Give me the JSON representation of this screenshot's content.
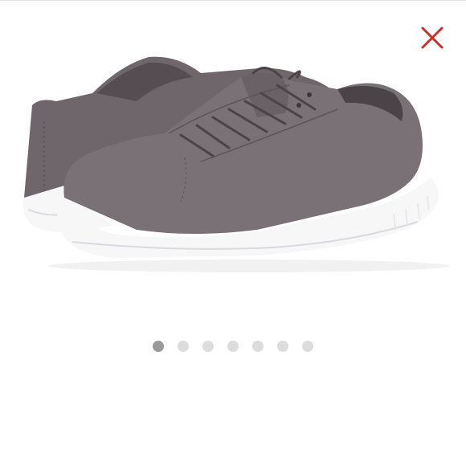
{
  "viewer": {
    "image": {
      "icon": "sneaker-product-image",
      "colors": {
        "suede": "#6f666c",
        "suede_dark": "#4a4347",
        "sole": "#f7f7f8",
        "sole_shadow": "#d9dade"
      }
    },
    "close": {
      "icon": "close-icon",
      "color": "#c9302c"
    },
    "pagination": {
      "count": 7,
      "active_index": 0,
      "active_color": "#9a9a9a",
      "inactive_color": "#dcdcdc"
    }
  }
}
